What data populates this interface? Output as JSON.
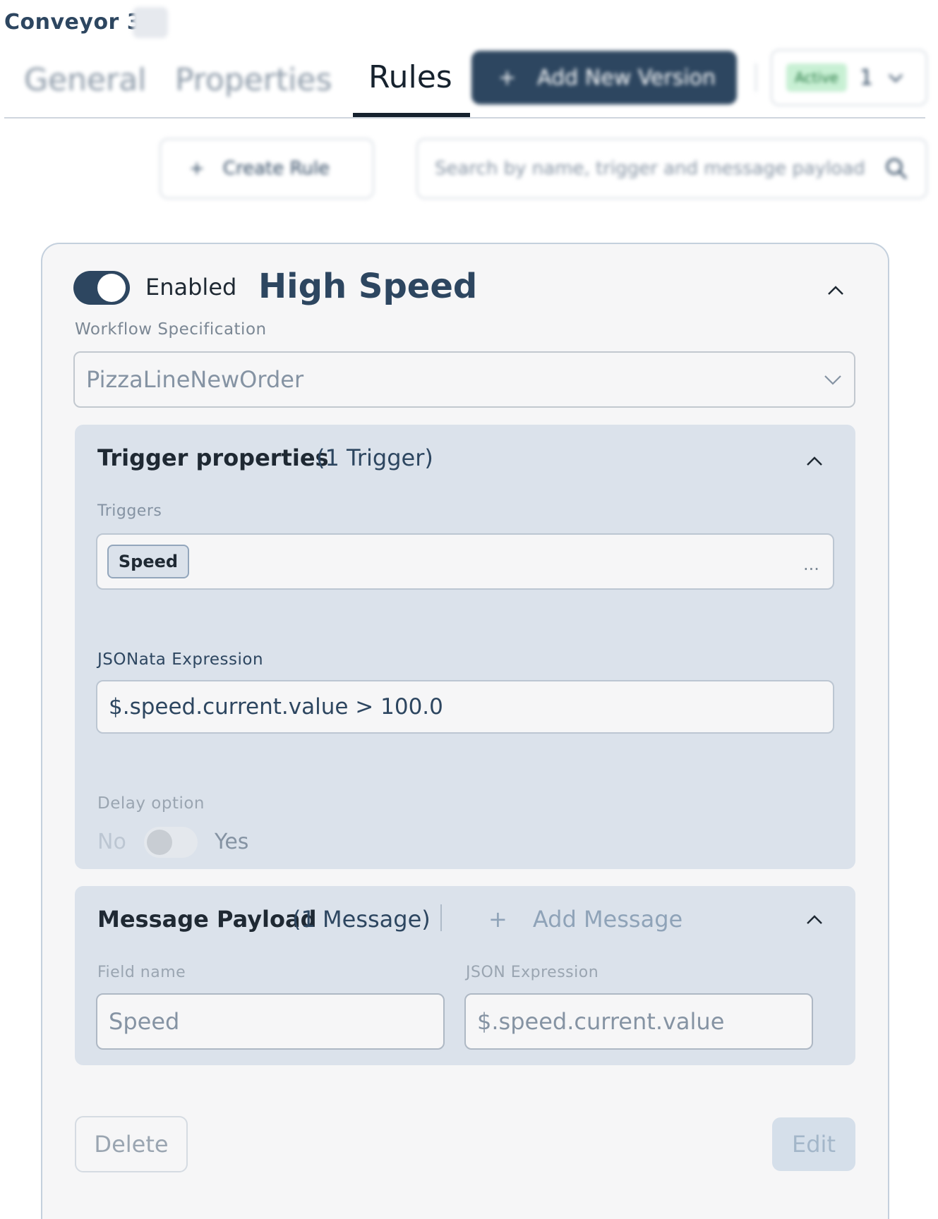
{
  "header": {
    "asset_title": "Conveyor 3",
    "tabs": [
      {
        "label": "General"
      },
      {
        "label": "Properties"
      },
      {
        "label": "Rules"
      }
    ],
    "add_version_label": "Add New Version",
    "version": {
      "status": "Active",
      "number": "1"
    }
  },
  "toolbar": {
    "create_rule_label": "Create Rule",
    "search_placeholder": "Search by name, trigger and message payload"
  },
  "rule": {
    "enabled_label": "Enabled",
    "title": "High Speed",
    "workflow_label": "Workflow Specification",
    "workflow_value": "PizzaLineNewOrder",
    "trigger_section": {
      "title": "Trigger properties",
      "count": "(1 Trigger)",
      "triggers_label": "Triggers",
      "triggers": [
        "Speed"
      ],
      "more": "...",
      "jsonata_label": "JSONata Expression",
      "jsonata_value": "$.speed.current.value > 100.0",
      "delay_label": "Delay option",
      "delay_no": "No",
      "delay_yes": "Yes"
    },
    "message_section": {
      "title": "Message Payload",
      "count": "(1 Message)",
      "add_label": "Add Message",
      "field_name_label": "Field name",
      "field_name_value": "Speed",
      "json_expression_label": "JSON Expression",
      "json_expression_value": "$.speed.current.value"
    },
    "delete_label": "Delete",
    "edit_label": "Edit"
  },
  "colors": {
    "primary": "#2d4660",
    "panel": "#dbe2eb",
    "card_bg": "#f6f6f7",
    "active_badge": "#c8f0d4"
  }
}
